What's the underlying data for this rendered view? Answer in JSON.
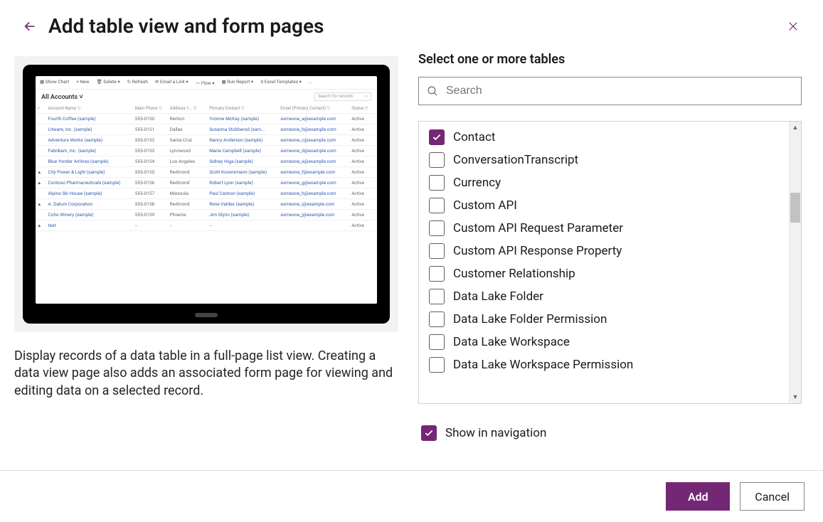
{
  "header": {
    "title": "Add table view and form pages"
  },
  "left": {
    "description": "Display records of a data table in a full-page list view. Creating a data view page also adds an associated form page for viewing and editing data on a selected record.",
    "preview": {
      "toolbar": {
        "show_chart": "Show Chart",
        "new": "+  New",
        "delete": "Delete",
        "refresh": "Refresh",
        "email_link": "Email a Link",
        "flow": "Flow",
        "run_report": "Run Report",
        "excel_templates": "Excel Templates"
      },
      "view_name": "All Accounts",
      "search_placeholder": "Search for records",
      "columns": [
        "",
        "Account Name",
        "Main Phone",
        "Address 1...",
        "Primary Contact",
        "Email (Primary Contact)",
        "Status"
      ],
      "rows": [
        {
          "flag": "",
          "name": "Fourth Coffee (sample)",
          "phone": "555-0150",
          "city": "Renton",
          "contact": "Yvonne McKay (sample)",
          "email": "someone_a@example.com",
          "status": "Active"
        },
        {
          "flag": "",
          "name": "Litware, Inc. (sample)",
          "phone": "555-0151",
          "city": "Dallas",
          "contact": "Susanna Stubberod (sam...",
          "email": "someone_b@example.com",
          "status": "Active"
        },
        {
          "flag": "",
          "name": "Adventure Works (sample)",
          "phone": "555-0152",
          "city": "Santa Cruz",
          "contact": "Nancy Anderson (sample)",
          "email": "someone_c@example.com",
          "status": "Active"
        },
        {
          "flag": "",
          "name": "Fabrikam, Inc. (sample)",
          "phone": "555-0153",
          "city": "Lynnwood",
          "contact": "Maria Campbell (sample)",
          "email": "someone_d@example.com",
          "status": "Active"
        },
        {
          "flag": "",
          "name": "Blue Yonder Airlines (sample)",
          "phone": "555-0154",
          "city": "Los Angeles",
          "contact": "Sidney Higa (sample)",
          "email": "someone_e@example.com",
          "status": "Active"
        },
        {
          "flag": "▲",
          "name": "City Power & Light (sample)",
          "phone": "555-0155",
          "city": "Redmond",
          "contact": "Scott Konersmann (sample)",
          "email": "someone_f@example.com",
          "status": "Active"
        },
        {
          "flag": "▲",
          "name": "Contoso Pharmaceuticals (sample)",
          "phone": "555-0156",
          "city": "Redmond",
          "contact": "Robert Lyon (sample)",
          "email": "someone_g@example.com",
          "status": "Active"
        },
        {
          "flag": "",
          "name": "Alpine Ski House (sample)",
          "phone": "555-0157",
          "city": "Missoula",
          "contact": "Paul Cannon (sample)",
          "email": "someone_h@example.com",
          "status": "Active"
        },
        {
          "flag": "▲",
          "name": "A. Datum Corporation",
          "phone": "555-0158",
          "city": "Redmond",
          "contact": "Rene Valdes (sample)",
          "email": "someone_i@example.com",
          "status": "Active"
        },
        {
          "flag": "",
          "name": "Coho Winery (sample)",
          "phone": "555-0159",
          "city": "Phoenix",
          "contact": "Jim Glynn (sample)",
          "email": "someone_j@example.com",
          "status": "Active"
        },
        {
          "flag": "▲",
          "name": "test",
          "phone": "--",
          "city": "--",
          "contact": "--",
          "email": "",
          "status": "Active"
        }
      ]
    }
  },
  "right": {
    "section_label": "Select one or more tables",
    "search_placeholder": "Search",
    "tables": [
      {
        "label": "Contact",
        "checked": true
      },
      {
        "label": "ConversationTranscript",
        "checked": false
      },
      {
        "label": "Currency",
        "checked": false
      },
      {
        "label": "Custom API",
        "checked": false
      },
      {
        "label": "Custom API Request Parameter",
        "checked": false
      },
      {
        "label": "Custom API Response Property",
        "checked": false
      },
      {
        "label": "Customer Relationship",
        "checked": false
      },
      {
        "label": "Data Lake Folder",
        "checked": false
      },
      {
        "label": "Data Lake Folder Permission",
        "checked": false
      },
      {
        "label": "Data Lake Workspace",
        "checked": false
      },
      {
        "label": "Data Lake Workspace Permission",
        "checked": false
      }
    ],
    "show_in_nav_label": "Show in navigation",
    "show_in_nav_checked": true
  },
  "footer": {
    "add_label": "Add",
    "cancel_label": "Cancel"
  }
}
